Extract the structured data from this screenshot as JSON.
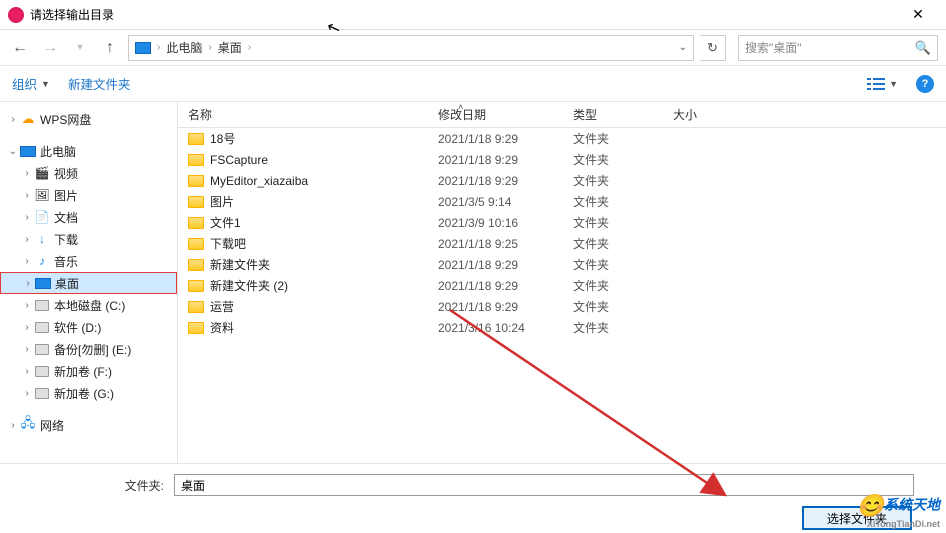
{
  "window": {
    "title": "请选择输出目录"
  },
  "breadcrumb": {
    "parts": [
      "此电脑",
      "桌面"
    ]
  },
  "search": {
    "placeholder": "搜索\"桌面\""
  },
  "toolbar": {
    "organize": "组织",
    "newfolder": "新建文件夹"
  },
  "columns": {
    "name": "名称",
    "date": "修改日期",
    "type": "类型",
    "size": "大小"
  },
  "tree": {
    "wps": "WPS网盘",
    "pc": "此电脑",
    "video": "视频",
    "pictures": "图片",
    "documents": "文档",
    "downloads": "下载",
    "music": "音乐",
    "desktop": "桌面",
    "disk_c": "本地磁盘 (C:)",
    "disk_d": "软件 (D:)",
    "disk_e": "备份[勿删] (E:)",
    "disk_f": "新加卷 (F:)",
    "disk_g": "新加卷 (G:)",
    "network": "网络"
  },
  "files": [
    {
      "name": "18号",
      "date": "2021/1/18 9:29",
      "type": "文件夹"
    },
    {
      "name": "FSCapture",
      "date": "2021/1/18 9:29",
      "type": "文件夹"
    },
    {
      "name": "MyEditor_xiazaiba",
      "date": "2021/1/18 9:29",
      "type": "文件夹"
    },
    {
      "name": "图片",
      "date": "2021/3/5 9:14",
      "type": "文件夹"
    },
    {
      "name": "文件1",
      "date": "2021/3/9 10:16",
      "type": "文件夹"
    },
    {
      "name": "下载吧",
      "date": "2021/1/18 9:25",
      "type": "文件夹"
    },
    {
      "name": "新建文件夹",
      "date": "2021/1/18 9:29",
      "type": "文件夹"
    },
    {
      "name": "新建文件夹 (2)",
      "date": "2021/1/18 9:29",
      "type": "文件夹"
    },
    {
      "name": "运营",
      "date": "2021/1/18 9:29",
      "type": "文件夹"
    },
    {
      "name": "资料",
      "date": "2021/3/16 10:24",
      "type": "文件夹"
    }
  ],
  "footer": {
    "label": "文件夹:",
    "value": "桌面",
    "button": "选择文件夹"
  },
  "watermark": {
    "text": "系统天地",
    "url": "XiTongTianDi.net"
  }
}
